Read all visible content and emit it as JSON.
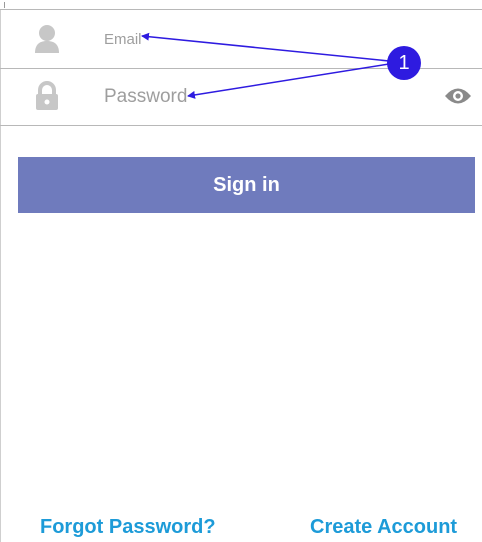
{
  "login_form": {
    "email": {
      "placeholder": "Email",
      "value": "",
      "icon": "person-icon"
    },
    "password": {
      "placeholder": "Password",
      "value": "",
      "icon": "lock-icon",
      "toggle_icon": "eye-icon"
    },
    "sign_in_label": "Sign in"
  },
  "links": {
    "forgot_password": "Forgot Password?",
    "create_account": "Create Account"
  },
  "annotation": {
    "number": "1"
  },
  "colors": {
    "button_bg": "#6f7bbd",
    "button_text": "#ffffff",
    "link": "#1d9bd8",
    "icon_gray": "#c7c7c7",
    "placeholder": "#9e9e9e",
    "annotation": "#2e1be0"
  }
}
